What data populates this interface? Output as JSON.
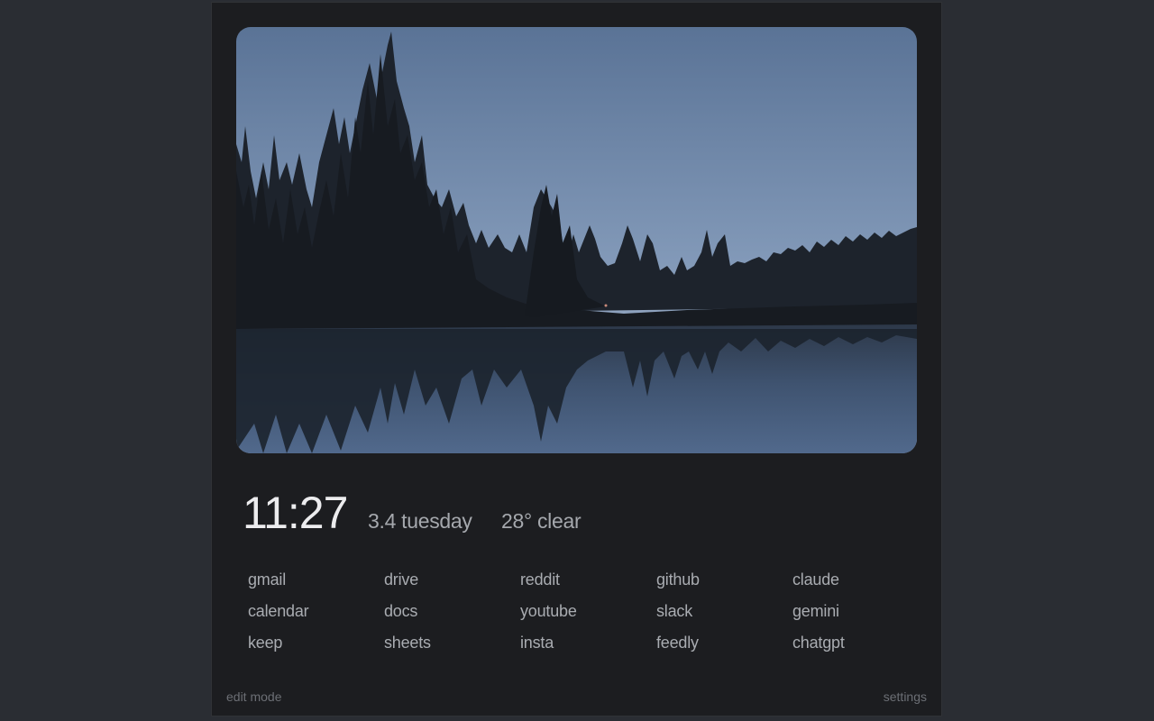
{
  "clock": {
    "time": "11:27"
  },
  "date": {
    "text": "3.4 tuesday"
  },
  "weather": {
    "text": "28° clear"
  },
  "links": [
    [
      "gmail",
      "drive",
      "reddit",
      "github",
      "claude"
    ],
    [
      "calendar",
      "docs",
      "youtube",
      "slack",
      "gemini"
    ],
    [
      "keep",
      "sheets",
      "insta",
      "feedly",
      "chatgpt"
    ]
  ],
  "footer": {
    "edit_label": "edit mode",
    "settings_label": "settings"
  },
  "colors": {
    "page_bg": "#2a2d33",
    "panel_bg": "#1c1d20",
    "sky_top": "#566f93",
    "sky_bottom": "#8fa3bf",
    "tree_silhouette": "#1b2027"
  }
}
